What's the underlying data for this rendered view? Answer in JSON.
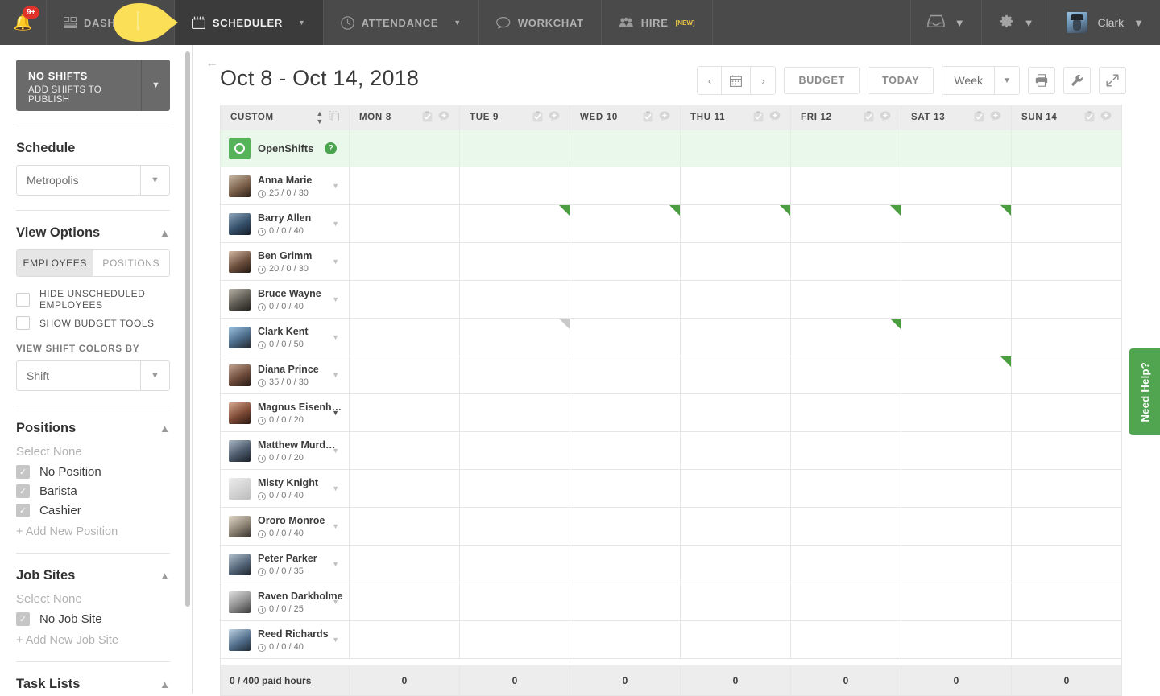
{
  "nav": {
    "bell_badge": "9+",
    "items": [
      {
        "label": "DASHBOARD",
        "icon": "dashboard-icon",
        "active": false,
        "caret": false
      },
      {
        "label": "SCHEDULER",
        "icon": "calendar-icon",
        "active": true,
        "caret": true
      },
      {
        "label": "ATTENDANCE",
        "icon": "clock-icon",
        "active": false,
        "caret": true
      },
      {
        "label": "WORKCHAT",
        "icon": "chat-icon",
        "active": false,
        "caret": false
      },
      {
        "label": "HIRE",
        "icon": "people-icon",
        "active": false,
        "caret": false,
        "superscript": "[NEW]"
      }
    ],
    "inbox_icon": "inbox-icon",
    "settings_icon": "gear-icon",
    "username": "Clark"
  },
  "sidebar": {
    "publish": {
      "title": "NO SHIFTS",
      "subtitle": "ADD SHIFTS TO PUBLISH"
    },
    "schedule": {
      "heading": "Schedule",
      "selected": "Metropolis"
    },
    "view_options": {
      "heading": "View Options",
      "tabs": [
        {
          "label": "EMPLOYEES",
          "active": true
        },
        {
          "label": "POSITIONS",
          "active": false
        }
      ],
      "checkboxes": [
        {
          "label": "HIDE UNSCHEDULED EMPLOYEES",
          "checked": false
        },
        {
          "label": "SHOW BUDGET TOOLS",
          "checked": false
        }
      ],
      "color_by_label": "VIEW SHIFT COLORS BY",
      "color_by_value": "Shift"
    },
    "positions": {
      "heading": "Positions",
      "select_none": "Select None",
      "items": [
        {
          "label": "No Position",
          "checked": true
        },
        {
          "label": "Barista",
          "checked": true
        },
        {
          "label": "Cashier",
          "checked": true
        }
      ],
      "add_new": "+ Add New Position"
    },
    "job_sites": {
      "heading": "Job Sites",
      "select_none": "Select None",
      "items": [
        {
          "label": "No Job Site",
          "checked": true
        }
      ],
      "add_new": "+ Add New Job Site"
    },
    "task_lists": {
      "heading": "Task Lists"
    }
  },
  "main": {
    "page_title": "Oct 8 - Oct 14, 2018",
    "toolbar": {
      "prev": "‹",
      "calendar_icon": "calendar-icon",
      "next": "›",
      "budget": "BUDGET",
      "today": "TODAY",
      "range_value": "Week",
      "print_icon": "printer-icon",
      "tools_icon": "wrench-icon",
      "expand_icon": "expand-icon"
    },
    "grid": {
      "name_column_header": "CUSTOM",
      "days": [
        "MON 8",
        "TUE 9",
        "WED 10",
        "THU 11",
        "FRI 12",
        "SAT 13",
        "SUN 14"
      ],
      "open_shifts_label": "OpenShifts",
      "open_shifts_help": "?",
      "rows": [
        {
          "name": "Anna Marie",
          "hours": "25 / 0 / 30",
          "caret_dark": false,
          "markers": [
            null,
            null,
            null,
            null,
            null,
            null,
            null
          ]
        },
        {
          "name": "Barry Allen",
          "hours": "0 / 0 / 40",
          "caret_dark": false,
          "markers": [
            null,
            "green",
            "green",
            "green",
            "green",
            "green",
            null
          ]
        },
        {
          "name": "Ben Grimm",
          "hours": "20 / 0 / 30",
          "caret_dark": false,
          "markers": [
            null,
            null,
            null,
            null,
            null,
            null,
            null
          ]
        },
        {
          "name": "Bruce Wayne",
          "hours": "0 / 0 / 40",
          "caret_dark": false,
          "markers": [
            null,
            null,
            null,
            null,
            null,
            null,
            null
          ]
        },
        {
          "name": "Clark Kent",
          "hours": "0 / 0 / 50",
          "caret_dark": false,
          "markers": [
            null,
            "gray",
            null,
            null,
            "green",
            null,
            null
          ]
        },
        {
          "name": "Diana Prince",
          "hours": "35 / 0 / 30",
          "caret_dark": false,
          "markers": [
            null,
            null,
            null,
            null,
            null,
            "green",
            null
          ]
        },
        {
          "name": "Magnus Eisenh…",
          "hours": "0 / 0 / 20",
          "caret_dark": true,
          "markers": [
            null,
            null,
            null,
            null,
            null,
            null,
            null
          ]
        },
        {
          "name": "Matthew Murd…",
          "hours": "0 / 0 / 20",
          "caret_dark": false,
          "markers": [
            null,
            null,
            null,
            null,
            null,
            null,
            null
          ]
        },
        {
          "name": "Misty Knight",
          "hours": "0 / 0 / 40",
          "caret_dark": false,
          "markers": [
            null,
            null,
            null,
            null,
            null,
            null,
            null
          ]
        },
        {
          "name": "Ororo Monroe",
          "hours": "0 / 0 / 40",
          "caret_dark": false,
          "markers": [
            null,
            null,
            null,
            null,
            null,
            null,
            null
          ]
        },
        {
          "name": "Peter Parker",
          "hours": "0 / 0 / 35",
          "caret_dark": false,
          "markers": [
            null,
            null,
            null,
            null,
            null,
            null,
            null
          ]
        },
        {
          "name": "Raven Darkholme",
          "hours": "0 / 0 / 25",
          "caret_dark": false,
          "markers": [
            null,
            null,
            null,
            null,
            null,
            null,
            null
          ]
        },
        {
          "name": "Reed Richards",
          "hours": "0 / 0 / 40",
          "caret_dark": false,
          "markers": [
            null,
            null,
            null,
            null,
            null,
            null,
            null
          ]
        }
      ],
      "footer_label": "0 / 400 paid hours",
      "footer_values": [
        "0",
        "0",
        "0",
        "0",
        "0",
        "0",
        "0"
      ]
    }
  },
  "need_help": {
    "label": "Need Help?"
  },
  "colors": {
    "nav_bg": "#4a4a4a",
    "nav_active": "#3b3b3b",
    "badge_red": "#e0342b",
    "open_shift_green": "#57b35a",
    "marker_green": "#4a9e3f",
    "marker_gray": "#c9c9c9",
    "help_green": "#51a551",
    "open_row_bg": "#e9f8ea",
    "cursor_yellow": "#fbdf57"
  }
}
